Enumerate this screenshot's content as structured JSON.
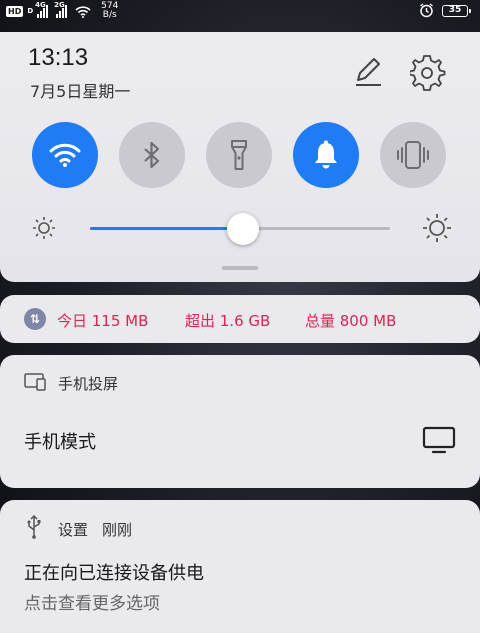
{
  "status_bar": {
    "hd_label": "HD",
    "hd_sub": "D",
    "signal1_gen": "4G",
    "signal2_gen": "2G",
    "speed_value": "574",
    "speed_unit": "B/s",
    "battery_level": "35",
    "icons": [
      "signal-icon",
      "wifi-icon",
      "alarm-icon",
      "battery-icon"
    ]
  },
  "quick_settings": {
    "time": "13:13",
    "date": "7月5日星期一",
    "toggles": [
      {
        "name": "wifi",
        "icon": "wifi-icon",
        "state": "on"
      },
      {
        "name": "bluetooth",
        "icon": "bluetooth-icon",
        "state": "off"
      },
      {
        "name": "flashlight",
        "icon": "flashlight-icon",
        "state": "off"
      },
      {
        "name": "notification-sound",
        "icon": "bell-icon",
        "state": "on"
      },
      {
        "name": "vibrate",
        "icon": "vibrate-icon",
        "state": "off"
      }
    ],
    "brightness_level": 0.51
  },
  "data_usage": {
    "today": "今日 115 MB",
    "exceeded": "超出 1.6 GB",
    "total": "总量 800 MB",
    "accent": "#e0244f"
  },
  "screen_projection": {
    "title": "手机投屏",
    "mode": "手机模式"
  },
  "usb_notification": {
    "app": "设置",
    "time": "刚刚",
    "title": "正在向已连接设备供电",
    "body": "点击查看更多选项"
  },
  "colors": {
    "accent_blue": "#1f7cf5",
    "panel_bg": "#e9e9ee",
    "toggle_off": "#c9c9cf"
  }
}
